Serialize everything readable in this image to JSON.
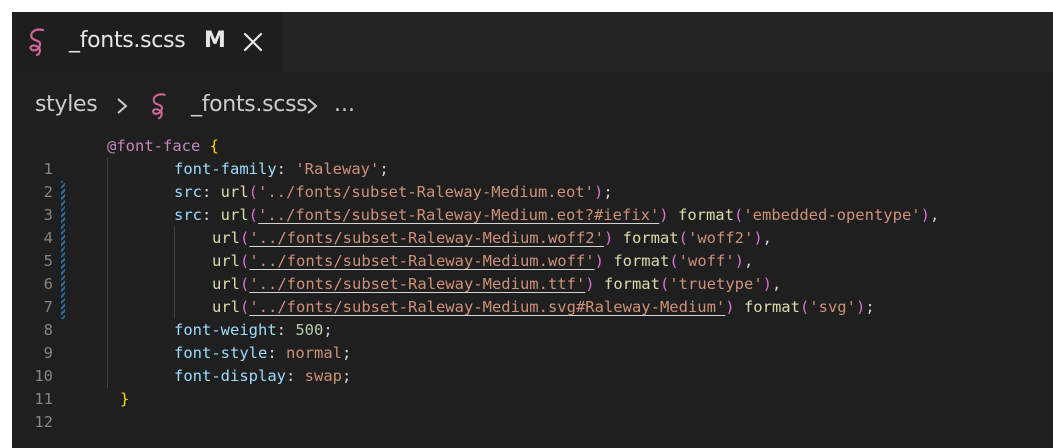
{
  "tab": {
    "icon": "sass-icon",
    "filename": "_fonts.scss",
    "modified_marker": "M",
    "close_icon": "close-icon"
  },
  "breadcrumb": {
    "folder": "styles",
    "file": "_fonts.scss",
    "more": "..."
  },
  "colors": {
    "sass_icon": "#cd6799",
    "editor_bg": "#1f1f1f",
    "modified_gutter": "#2b6ea8"
  },
  "code": {
    "lines": [
      {
        "n": "1",
        "mod": false
      },
      {
        "n": "2",
        "mod": false
      },
      {
        "n": "3",
        "mod": true
      },
      {
        "n": "4",
        "mod": true
      },
      {
        "n": "5",
        "mod": true
      },
      {
        "n": "6",
        "mod": true
      },
      {
        "n": "7",
        "mod": true
      },
      {
        "n": "8",
        "mod": true
      },
      {
        "n": "9",
        "mod": false
      },
      {
        "n": "10",
        "mod": false
      },
      {
        "n": "11",
        "mod": false
      },
      {
        "n": "12",
        "mod": false
      }
    ],
    "l1": {
      "at": "@font-face",
      "brace": "{"
    },
    "l2": {
      "prop": "font-family",
      "colon": ": ",
      "value": "'Raleway'",
      "semi": ";"
    },
    "l3": {
      "prop": "src",
      "colon": ": ",
      "fn": "url",
      "open": "(",
      "str": "'../fonts/subset-Raleway-Medium.eot'",
      "close": ")",
      "semi": ";"
    },
    "l4": {
      "prop": "src",
      "colon": ": ",
      "fn": "url",
      "open": "(",
      "str": "'../fonts/subset-Raleway-Medium.eot?#iefix'",
      "close": ")",
      "fn2": "format",
      "str2": "'embedded-opentype'",
      "tail": ","
    },
    "l5": {
      "fn": "url",
      "open": "(",
      "str": "'../fonts/subset-Raleway-Medium.woff2'",
      "close": ")",
      "fn2": "format",
      "str2": "'woff2'",
      "tail": ","
    },
    "l6": {
      "fn": "url",
      "open": "(",
      "str": "'../fonts/subset-Raleway-Medium.woff'",
      "close": ")",
      "fn2": "format",
      "str2": "'woff'",
      "tail": ","
    },
    "l7": {
      "fn": "url",
      "open": "(",
      "str": "'../fonts/subset-Raleway-Medium.ttf'",
      "close": ")",
      "fn2": "format",
      "str2": "'truetype'",
      "tail": ","
    },
    "l8": {
      "fn": "url",
      "open": "(",
      "str": "'../fonts/subset-Raleway-Medium.svg#Raleway-Medium'",
      "close": ")",
      "fn2": "format",
      "str2": "'svg'",
      "tail": ";"
    },
    "l9": {
      "prop": "font-weight",
      "colon": ": ",
      "value": "500",
      "semi": ";"
    },
    "l10": {
      "prop": "font-style",
      "colon": ": ",
      "value": "normal",
      "semi": ";"
    },
    "l11": {
      "prop": "font-display",
      "colon": ": ",
      "value": "swap",
      "semi": ";"
    },
    "l12": {
      "brace": "}"
    }
  }
}
